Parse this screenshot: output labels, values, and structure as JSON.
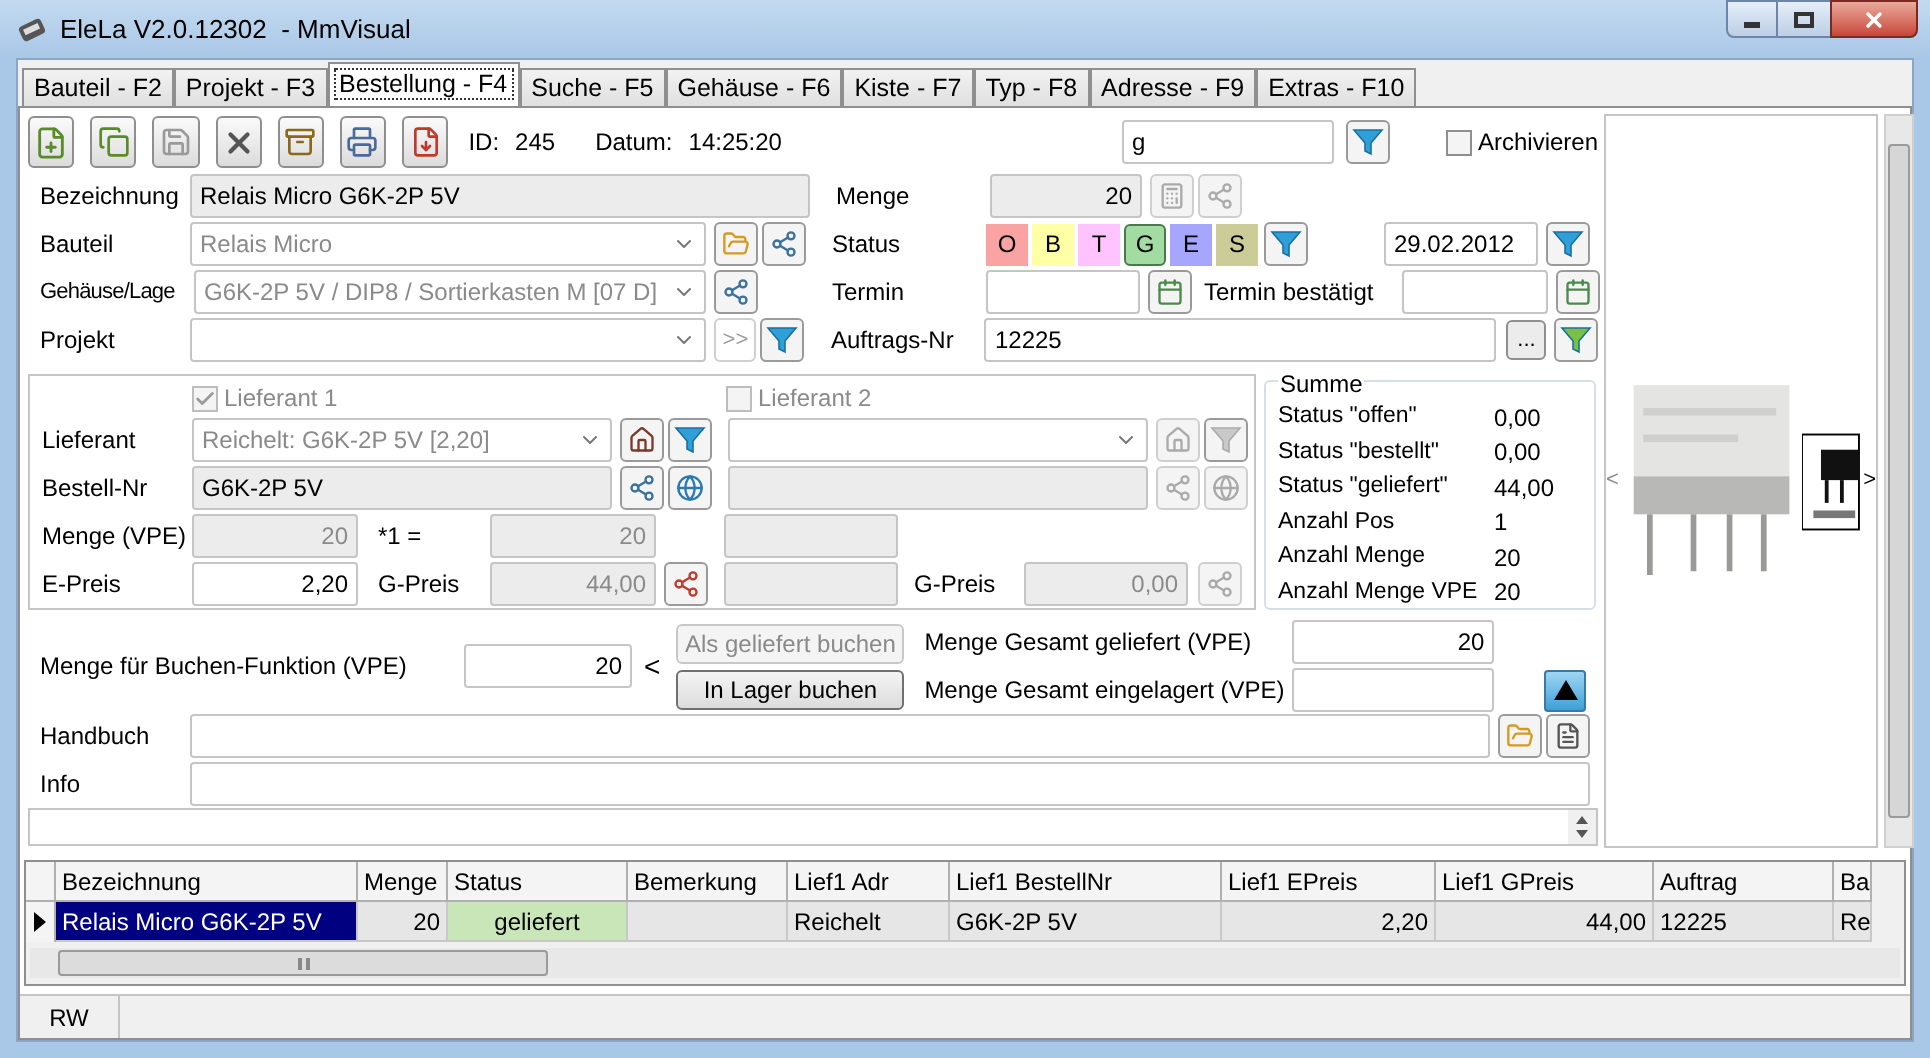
{
  "window": {
    "title": "EleLa V2.0.12302  - MmVisual"
  },
  "tabs": [
    {
      "label": "Bauteil - F2",
      "selected": false
    },
    {
      "label": "Projekt - F3",
      "selected": false
    },
    {
      "label": "Bestellung - F4",
      "selected": true
    },
    {
      "label": "Suche - F5",
      "selected": false
    },
    {
      "label": "Gehäuse - F6",
      "selected": false
    },
    {
      "label": "Kiste - F7",
      "selected": false
    },
    {
      "label": "Typ - F8",
      "selected": false
    },
    {
      "label": "Adresse - F9",
      "selected": false
    },
    {
      "label": "Extras - F10",
      "selected": false
    }
  ],
  "toolbar": {
    "id_label": "ID:",
    "id": "245",
    "date_label": "Datum:",
    "date": "14:25:20",
    "search": "g",
    "archive": {
      "label": "Archivieren",
      "checked": false
    }
  },
  "order": {
    "bezeichnung": {
      "label": "Bezeichnung",
      "value": "Relais Micro G6K-2P 5V"
    },
    "bauteil": {
      "label": "Bauteil",
      "value": "Relais Micro"
    },
    "gehaeuse": {
      "label": "Gehäuse/Lage",
      "value": "G6K-2P 5V / DIP8 / Sortierkasten M [07 D]"
    },
    "projekt": {
      "label": "Projekt",
      "button": ">>"
    },
    "menge": {
      "label": "Menge",
      "value": "20"
    },
    "status": {
      "label": "Status",
      "date": "29.02.2012",
      "chips": [
        {
          "label": "O",
          "color": "#f9a3a3",
          "selected": false
        },
        {
          "label": "B",
          "color": "#ffffa6",
          "selected": false
        },
        {
          "label": "T",
          "color": "#ffc4ff",
          "selected": false
        },
        {
          "label": "G",
          "color": "#a3dca3",
          "selected": true
        },
        {
          "label": "E",
          "color": "#a6a6ff",
          "selected": false
        },
        {
          "label": "S",
          "color": "#cccc99",
          "selected": false
        }
      ]
    },
    "termin": {
      "label": "Termin",
      "confirmed_label": "Termin bestätigt"
    },
    "auftrag": {
      "label": "Auftrags-Nr",
      "value": "12225",
      "button": "..."
    }
  },
  "suppliers": {
    "labels": {
      "lieferant": "Lieferant",
      "bestell_nr": "Bestell-Nr",
      "menge": "Menge (VPE)",
      "e_preis": "E-Preis"
    },
    "factor": "*1 =",
    "supplier_1": {
      "label": "Lieferant 1",
      "checked": true,
      "lieferant": "Reichelt: G6K-2P 5V [2,20]",
      "bestell_nr": "G6K-2P 5V",
      "menge": "20",
      "menge_total": "20",
      "e_preis": "2,20",
      "g_preis_label": "G-Preis",
      "g_preis": "44,00"
    },
    "supplier_2": {
      "label": "Lieferant 2",
      "checked": false,
      "g_preis_label": "G-Preis",
      "g_preis": "0,00"
    }
  },
  "summe": {
    "title": "Summe",
    "rows": [
      {
        "label": "Status \"offen\"",
        "value": "0,00"
      },
      {
        "label": "Status \"bestellt\"",
        "value": "0,00"
      },
      {
        "label": "Status \"geliefert\"",
        "value": "44,00"
      },
      {
        "label": "Anzahl Pos",
        "value": "1"
      },
      {
        "label": "Anzahl Menge",
        "value": "20"
      },
      {
        "label": "Anzahl Menge VPE",
        "value": "20"
      }
    ]
  },
  "booking": {
    "label": "Menge für Buchen-Funktion (VPE)",
    "value": "20",
    "arrow": "<",
    "buttons": [
      {
        "label": "Als geliefert buchen",
        "disabled": true
      },
      {
        "label": "In Lager buchen",
        "disabled": false
      }
    ],
    "delivered_label": "Menge Gesamt geliefert (VPE)",
    "delivered": "20",
    "stored_label": "Menge Gesamt eingelagert (VPE)"
  },
  "handbuch": {
    "label": "Handbuch"
  },
  "info": {
    "label": "Info"
  },
  "gallery": {
    "prev": "<",
    "next": ">"
  },
  "table": {
    "columns": [
      "Bezeichnung",
      "Menge",
      "Status",
      "Bemerkung",
      "Lief1 Adr",
      "Lief1 BestellNr",
      "Lief1 EPreis",
      "Lief1 GPreis",
      "Auftrag",
      "Ba"
    ],
    "rows": [
      {
        "selected": true,
        "cells": [
          "Relais Micro G6K-2P 5V",
          "20",
          "geliefert",
          null,
          "Reichelt",
          "G6K-2P 5V",
          "2,20",
          "44,00",
          "12225",
          "Re"
        ]
      }
    ]
  },
  "status_bar": {
    "mode": "RW"
  }
}
